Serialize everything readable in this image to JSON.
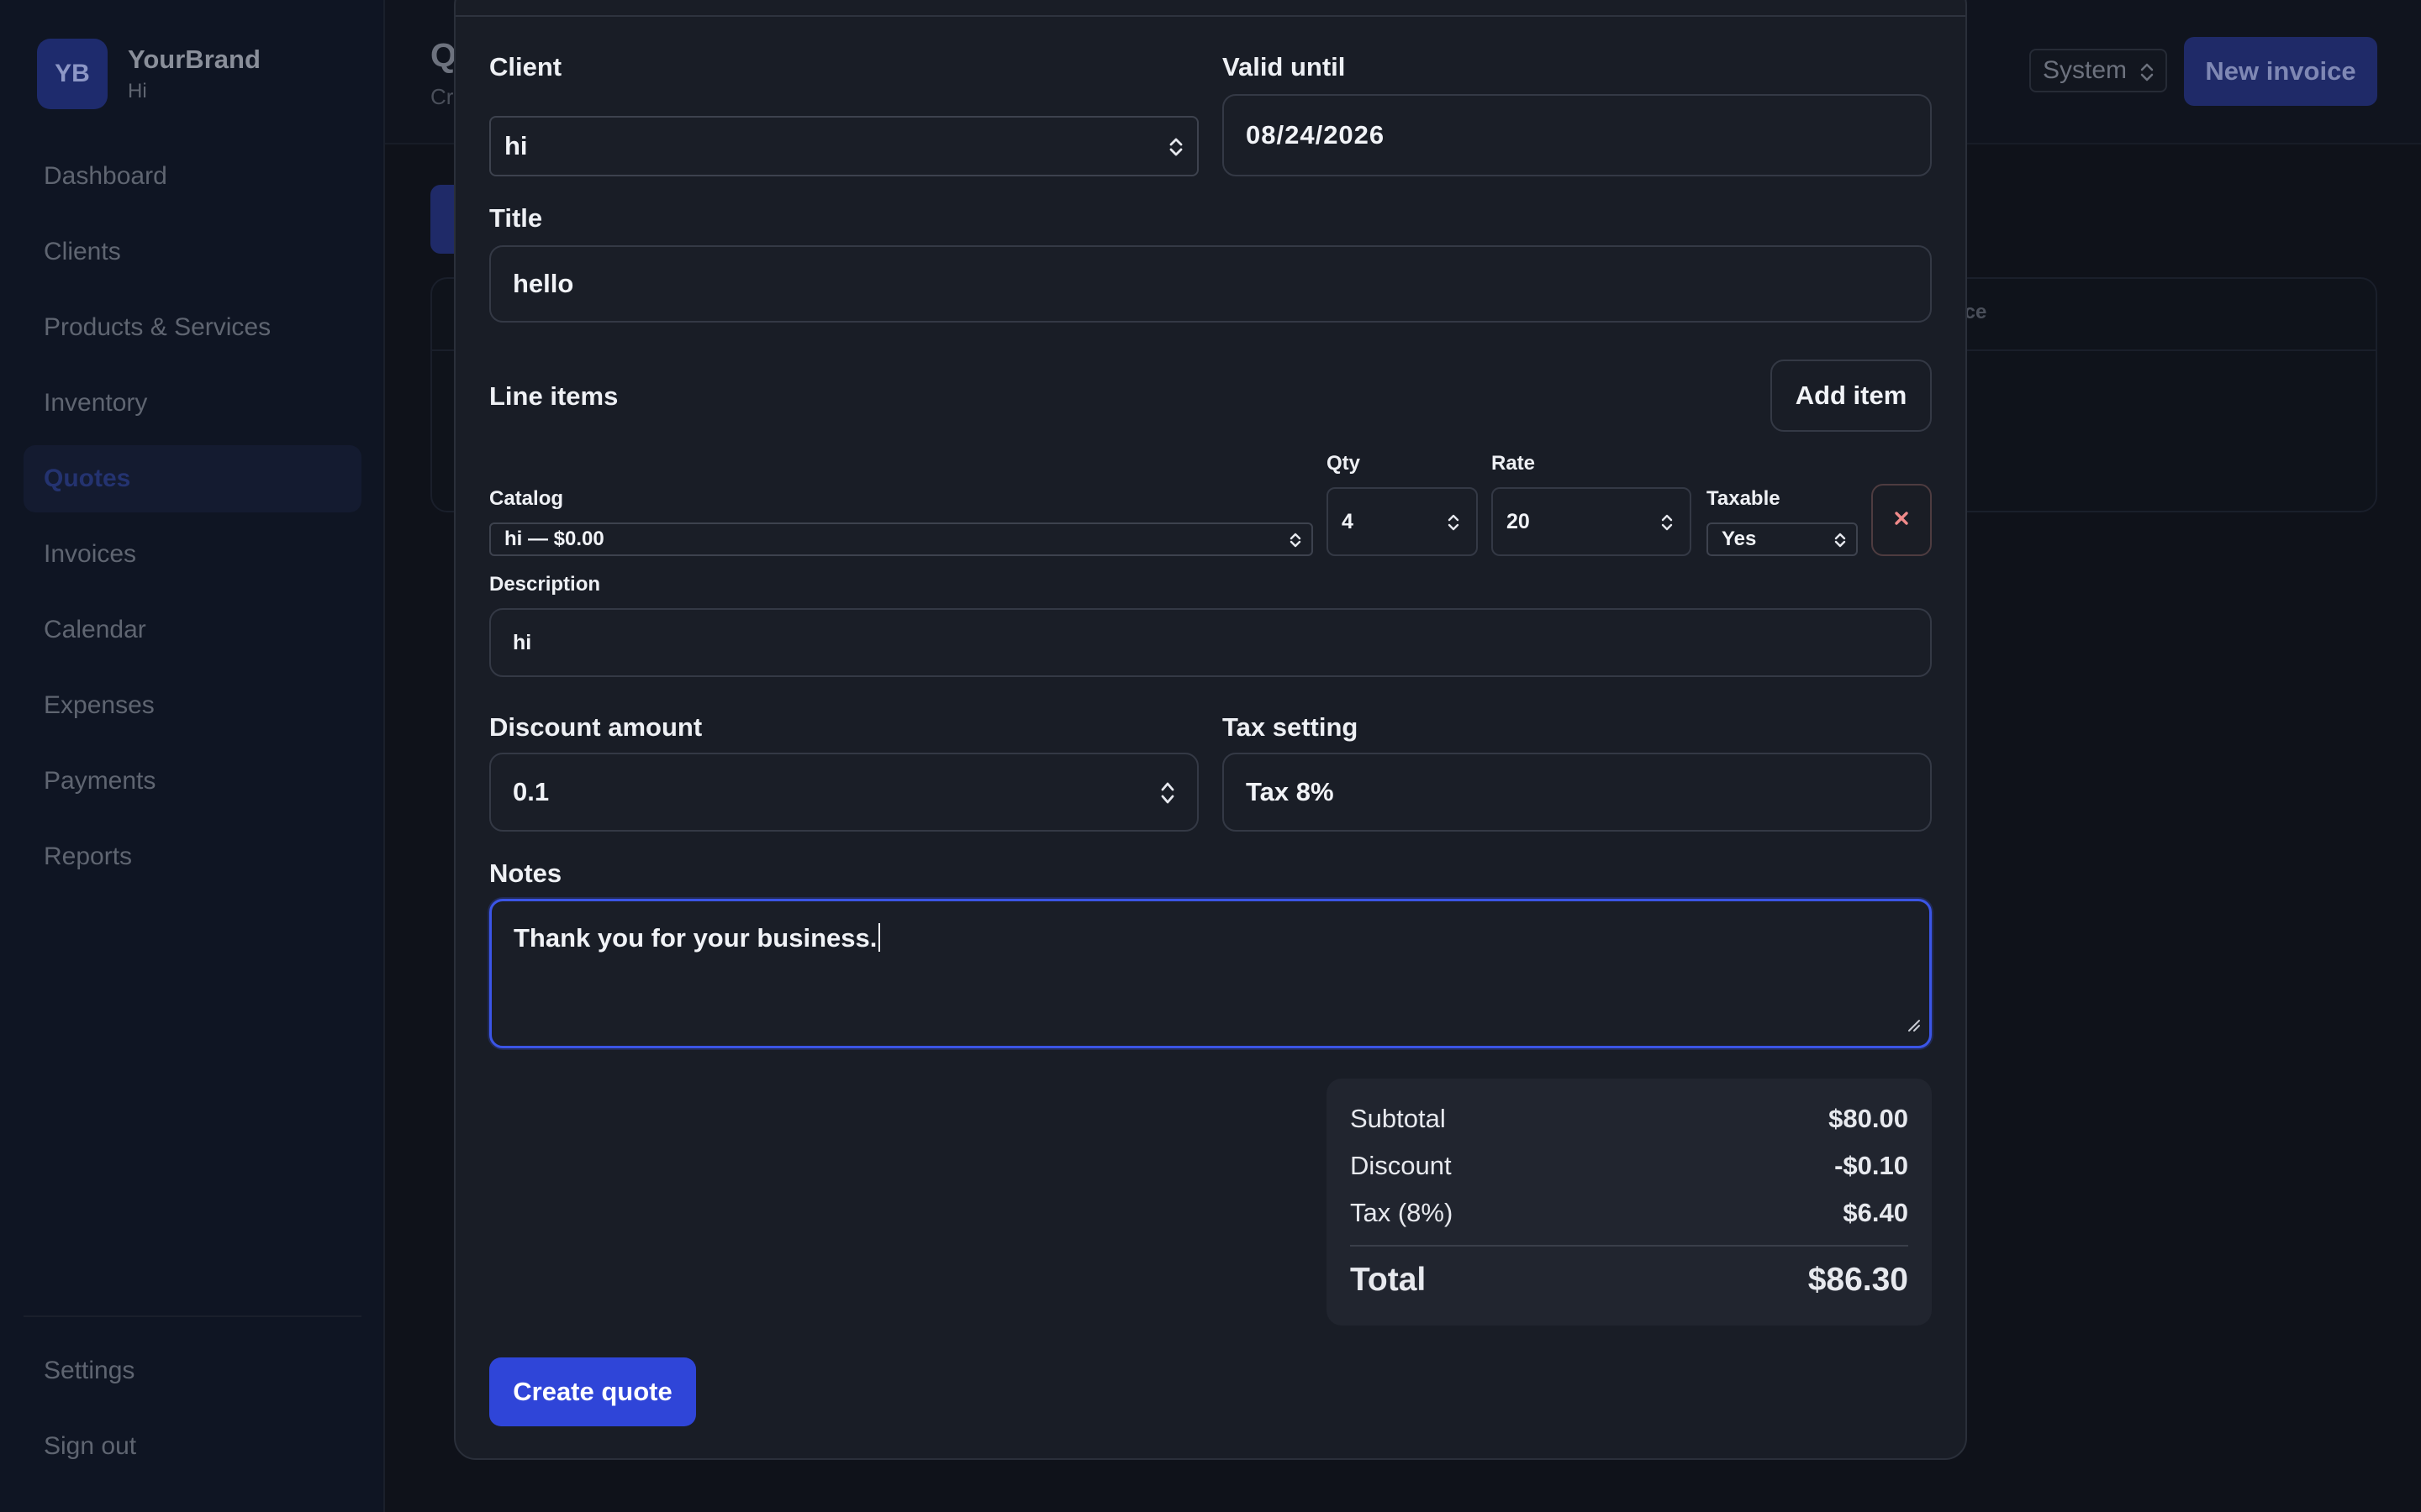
{
  "brand": {
    "initials": "YB",
    "name": "YourBrand",
    "subtitle": "Hi"
  },
  "sidebar": {
    "items": [
      {
        "label": "Dashboard"
      },
      {
        "label": "Clients"
      },
      {
        "label": "Products & Services"
      },
      {
        "label": "Inventory"
      },
      {
        "label": "Quotes",
        "active": true
      },
      {
        "label": "Invoices"
      },
      {
        "label": "Calendar"
      },
      {
        "label": "Expenses"
      },
      {
        "label": "Payments"
      },
      {
        "label": "Reports"
      }
    ],
    "bottom_items": [
      {
        "label": "Settings"
      },
      {
        "label": "Sign out"
      }
    ]
  },
  "header": {
    "title_visible": "Q",
    "subtitle_visible": "Cr",
    "theme_select": "System",
    "new_invoice_label": "New invoice",
    "table_header_partial": "nce"
  },
  "form": {
    "client": {
      "label": "Client",
      "value": "hi"
    },
    "valid_until": {
      "label": "Valid until",
      "value": "08/24/2026"
    },
    "title": {
      "label": "Title",
      "value": "hello"
    },
    "line_items": {
      "label": "Line items",
      "add_label": "Add item",
      "items": [
        {
          "catalog_label": "Catalog",
          "catalog_value": "hi — $0.00",
          "qty_label": "Qty",
          "qty_value": "4",
          "rate_label": "Rate",
          "rate_value": "20",
          "taxable_label": "Taxable",
          "taxable_value": "Yes",
          "remove_label": "×",
          "description_label": "Description",
          "description_value": "hi"
        }
      ]
    },
    "discount": {
      "label": "Discount amount",
      "value": "0.1"
    },
    "tax_setting": {
      "label": "Tax setting",
      "value": "Tax 8%"
    },
    "notes": {
      "label": "Notes",
      "value": "Thank you for your business."
    }
  },
  "totals": {
    "subtotal_label": "Subtotal",
    "subtotal": "$80.00",
    "discount_label": "Discount",
    "discount": "-$0.10",
    "tax_label": "Tax (8%)",
    "tax": "$6.40",
    "total_label": "Total",
    "total": "$86.30"
  },
  "actions": {
    "create_label": "Create quote"
  },
  "colors": {
    "accent": "#2f45d8",
    "focus_ring": "#3b55e6",
    "modal_bg": "#191d26",
    "remove_icon": "#f08a8a"
  },
  "icons": [
    "updown-chevron-icon",
    "close-icon",
    "resize-grip-icon"
  ]
}
